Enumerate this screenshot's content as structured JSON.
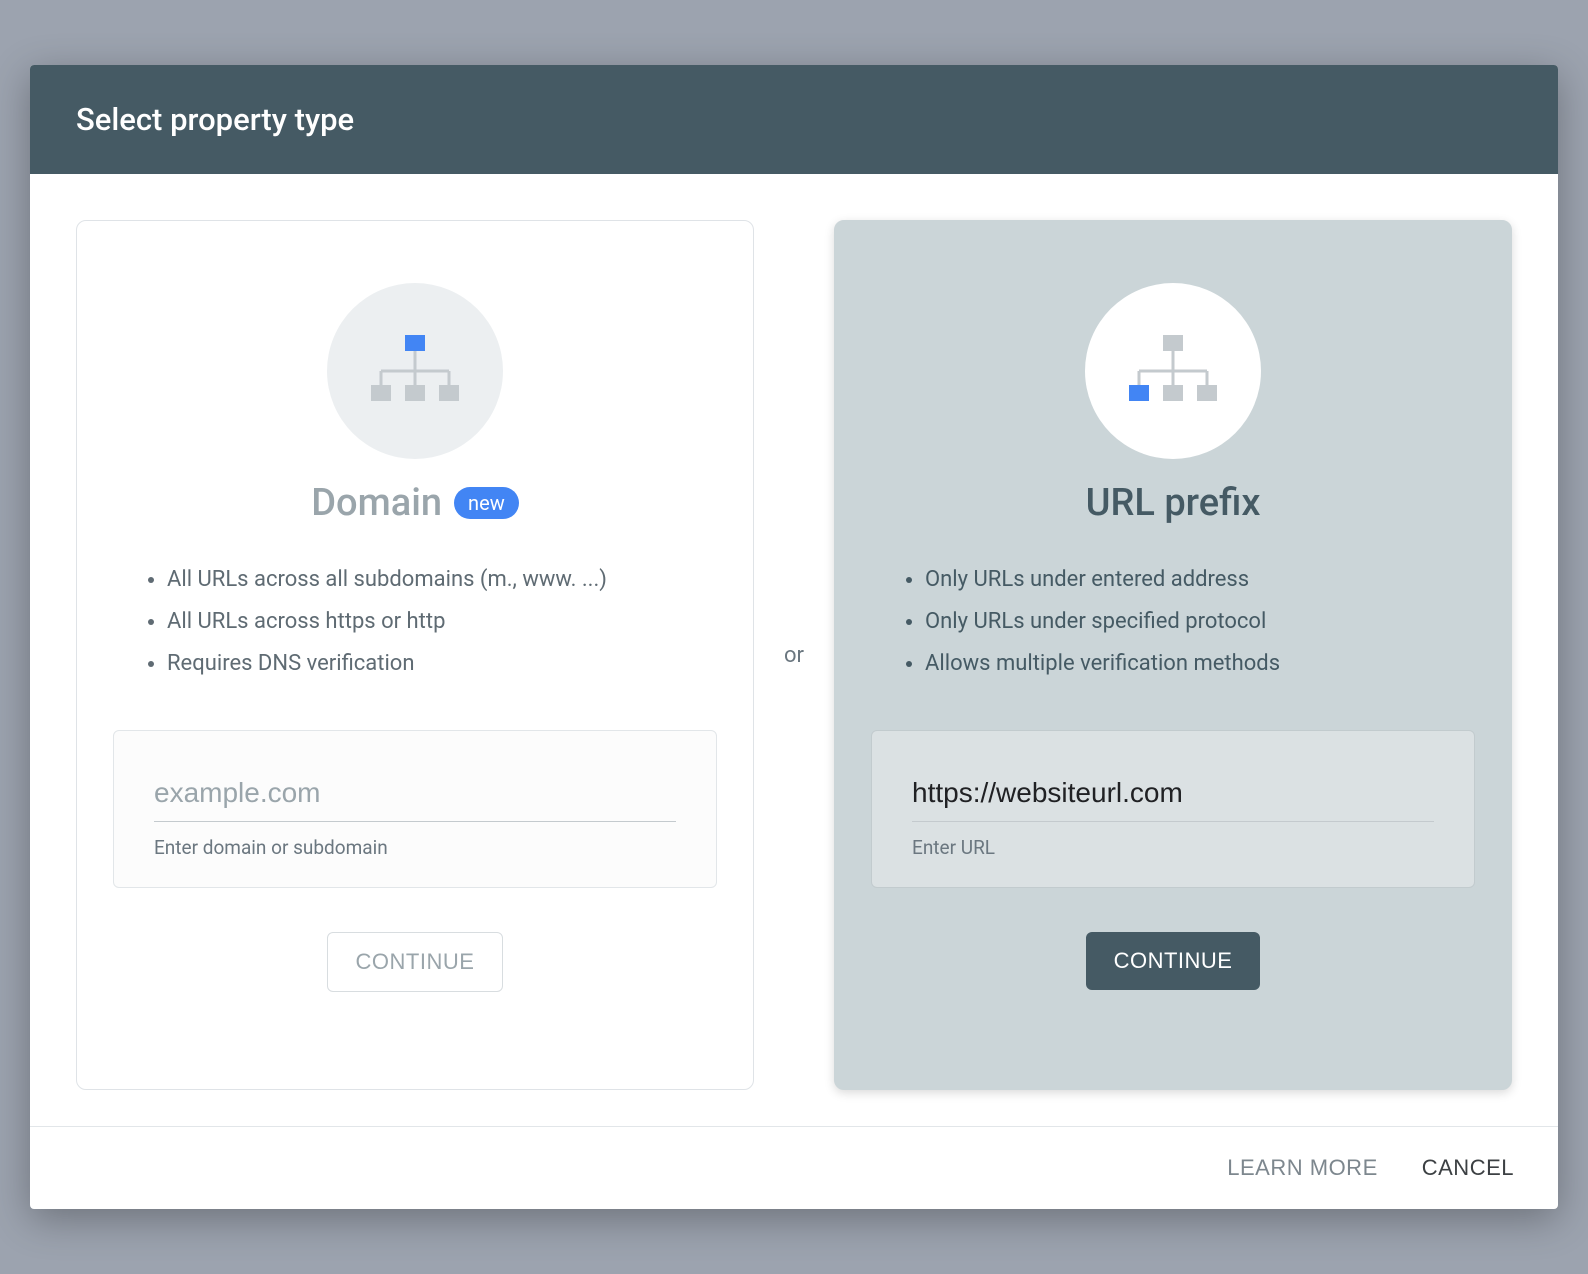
{
  "header": {
    "title": "Select property type"
  },
  "divider_label": "or",
  "domain_card": {
    "title": "Domain",
    "badge": "new",
    "features": [
      "All URLs across all subdomains (m., www. ...)",
      "All URLs across https or http",
      "Requires DNS verification"
    ],
    "input_placeholder": "example.com",
    "input_value": "",
    "input_helper": "Enter domain or subdomain",
    "continue_label": "CONTINUE"
  },
  "url_card": {
    "title": "URL prefix",
    "features": [
      "Only URLs under entered address",
      "Only URLs under specified protocol",
      "Allows multiple verification methods"
    ],
    "input_placeholder": "",
    "input_value": "https://websiteurl.com",
    "input_helper": "Enter URL",
    "continue_label": "CONTINUE"
  },
  "footer": {
    "learn_more": "LEARN MORE",
    "cancel": "CANCEL"
  }
}
